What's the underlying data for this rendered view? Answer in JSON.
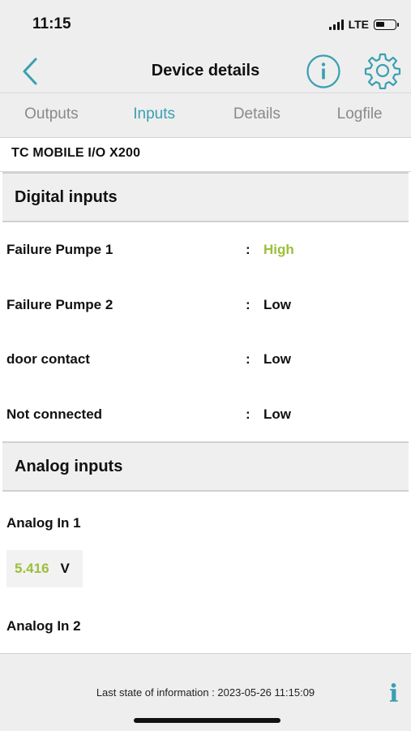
{
  "status_bar": {
    "time": "11:15",
    "network": "LTE"
  },
  "header": {
    "title": "Device details",
    "back_icon": "chevron-left-icon",
    "info_icon": "info-circle-icon",
    "settings_icon": "gear-icon",
    "accent": "#3a9fb2"
  },
  "tabs": [
    {
      "label": "Outputs",
      "active": false
    },
    {
      "label": "Inputs",
      "active": true
    },
    {
      "label": "Details",
      "active": false
    },
    {
      "label": "Logfile",
      "active": false
    }
  ],
  "device": {
    "name": "TC MOBILE I/O X200"
  },
  "digital_inputs": {
    "heading": "Digital inputs",
    "rows": [
      {
        "label": "Failure Pumpe 1",
        "separator": ":",
        "value": "High"
      },
      {
        "label": "Failure Pumpe 2",
        "separator": ":",
        "value": "Low"
      },
      {
        "label": "door contact",
        "separator": ":",
        "value": "Low"
      },
      {
        "label": "Not connected",
        "separator": ":",
        "value": "Low"
      }
    ]
  },
  "analog_inputs": {
    "heading": "Analog inputs",
    "items": [
      {
        "label": "Analog In 1",
        "value": "5.416",
        "unit": "V"
      },
      {
        "label": "Analog In 2"
      }
    ]
  },
  "footer": {
    "text": "Last state of information : 2023-05-26 11:15:09",
    "info_glyph": "i"
  },
  "colors": {
    "high": "#9bbf3a",
    "accent": "#3a9fb2"
  }
}
